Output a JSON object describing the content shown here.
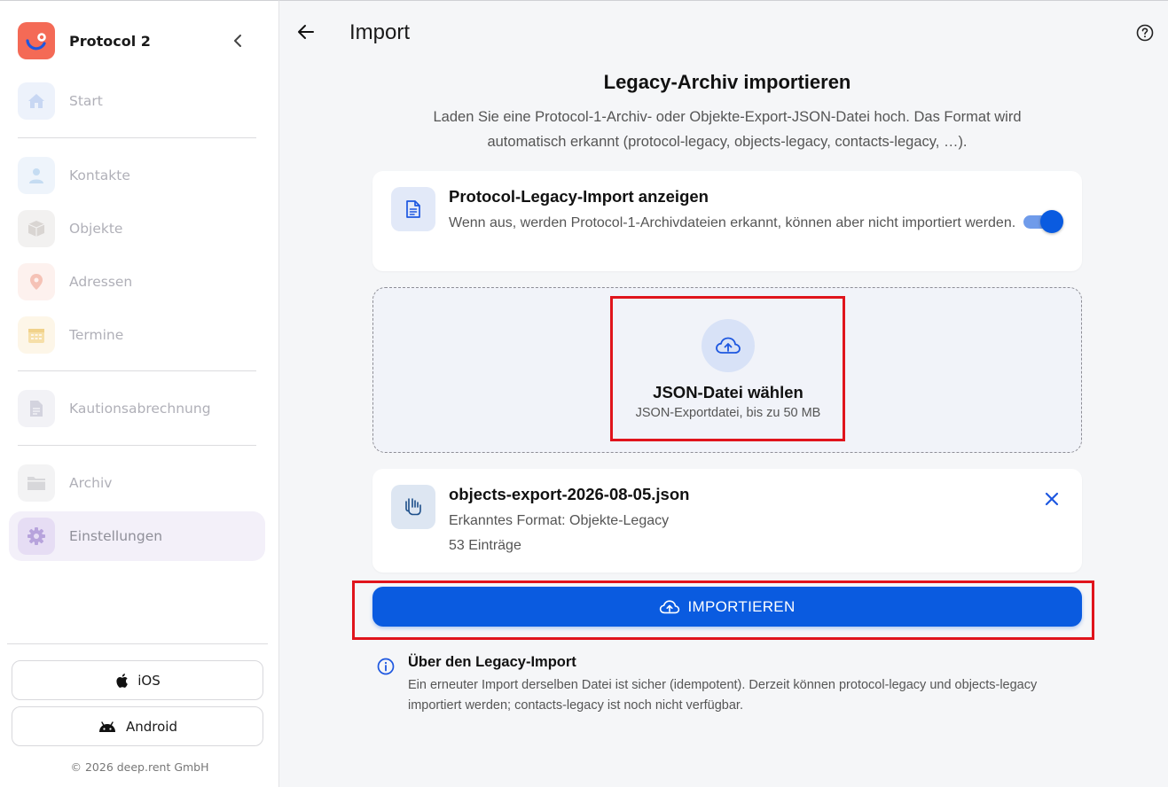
{
  "sidebar": {
    "app_name": "Protocol 2",
    "items": [
      {
        "label": "Start"
      },
      {
        "label": "Kontakte"
      },
      {
        "label": "Objekte"
      },
      {
        "label": "Adressen"
      },
      {
        "label": "Termine"
      },
      {
        "label": "Kautionsabrechnung"
      },
      {
        "label": "Archiv"
      },
      {
        "label": "Einstellungen",
        "active": true
      }
    ],
    "ios_label": "iOS",
    "android_label": "Android",
    "copyright": "© 2026 deep.rent GmbH"
  },
  "header": {
    "title": "Import"
  },
  "hero": {
    "title": "Legacy-Archiv importieren",
    "description": "Laden Sie eine Protocol-1-Archiv- oder Objekte-Export-JSON-Datei hoch. Das Format wird automatisch erkannt (protocol-legacy, objects-legacy, contacts-legacy, …)."
  },
  "toggle_card": {
    "title": "Protocol-Legacy-Import anzeigen",
    "description": "Wenn aus, werden Protocol-1-Archivdateien erkannt, können aber nicht importiert werden.",
    "enabled": true
  },
  "dropzone": {
    "title": "JSON-Datei wählen",
    "subtitle": "JSON-Exportdatei, bis zu 50 MB"
  },
  "file_card": {
    "filename": "objects-export-2026-08-05.json",
    "format": "Erkanntes Format: Objekte-Legacy",
    "entries": "53 Einträge"
  },
  "import_button": {
    "label": "IMPORTIEREN"
  },
  "info": {
    "title": "Über den Legacy-Import",
    "text": "Ein erneuter Import derselben Datei ist sicher (idempotent). Derzeit können protocol-legacy und objects-legacy importiert werden; contacts-legacy ist noch nicht verfügbar."
  },
  "colors": {
    "brand": "#f46a56",
    "accent": "#0a5be0",
    "highlight": "#e0141c"
  }
}
